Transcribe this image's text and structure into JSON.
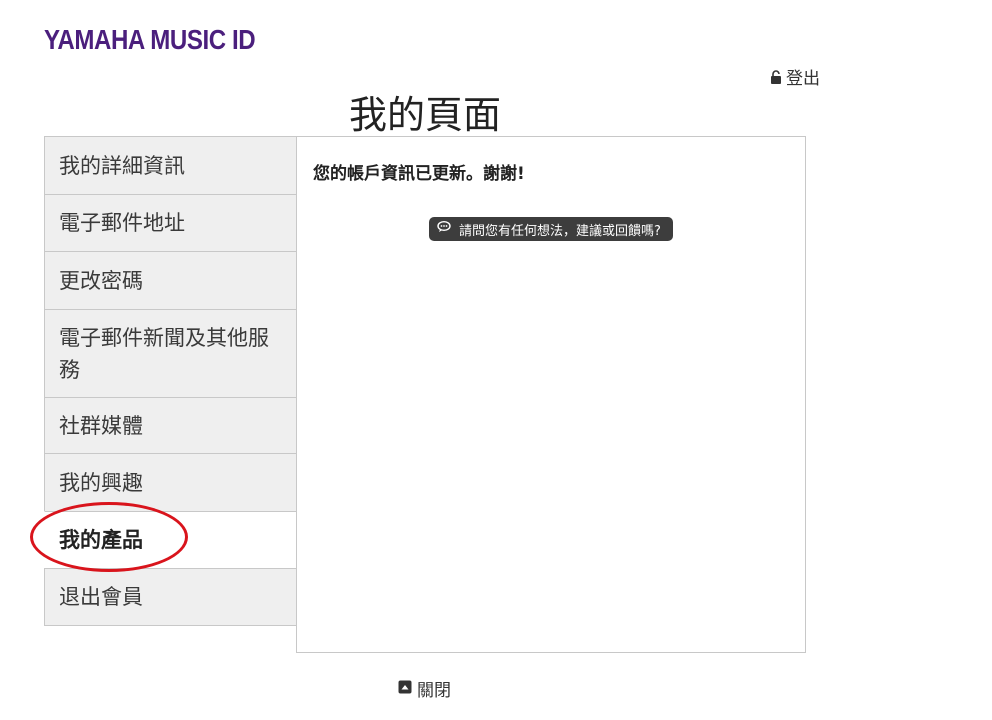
{
  "brand": {
    "logo_text": "YAMAHA MUSIC ID"
  },
  "header": {
    "logout_label": "登出",
    "page_title": "我的頁面"
  },
  "sidebar": {
    "items": [
      {
        "label": "我的詳細資訊",
        "active": false
      },
      {
        "label": "電子郵件地址",
        "active": false
      },
      {
        "label": "更改密碼",
        "active": false
      },
      {
        "label": "電子郵件新聞及其他服務",
        "active": false
      },
      {
        "label": "社群媒體",
        "active": false
      },
      {
        "label": "我的興趣",
        "active": false
      },
      {
        "label": "我的產品",
        "active": true
      },
      {
        "label": "退出會員",
        "active": false
      }
    ]
  },
  "main": {
    "message": "您的帳戶資訊已更新。謝謝!",
    "feedback_label": "請問您有任何想法，建議或回饋嗎?"
  },
  "footer": {
    "close_label": "關閉"
  },
  "colors": {
    "brand": "#4b1f7d",
    "highlight": "#d9141c",
    "nav_bg": "#efefef",
    "pill_bg": "#3d3d3d"
  },
  "icons": {
    "logout": "unlock-icon",
    "feedback": "speech-bubble-icon",
    "close": "caret-up-box-icon"
  }
}
